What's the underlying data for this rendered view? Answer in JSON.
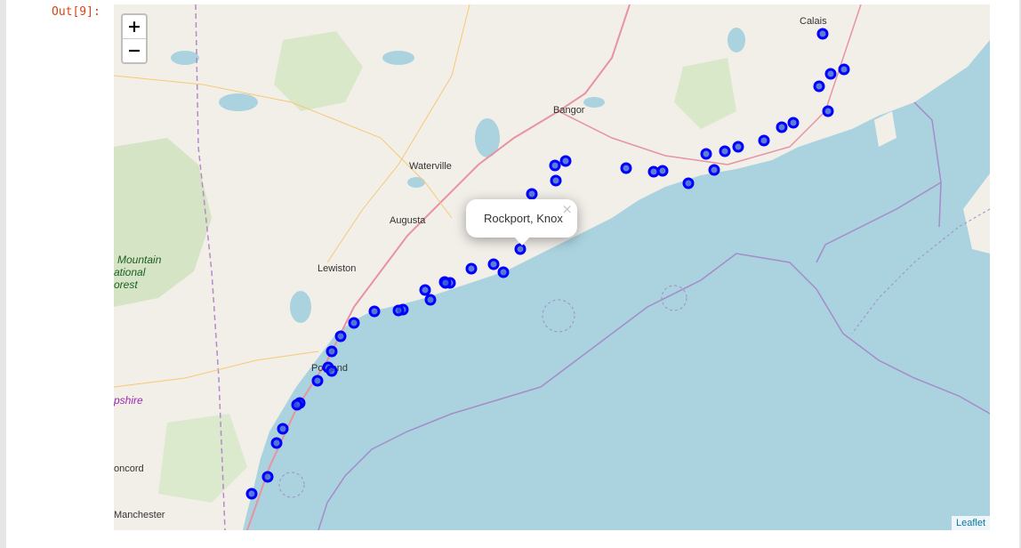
{
  "notebook": {
    "out_prompt": "Out[9]:"
  },
  "map": {
    "zoom_in_label": "+",
    "zoom_out_label": "−",
    "attribution": "Leaflet",
    "colors": {
      "water": "#aad3df",
      "land": "#f2efe9",
      "marker_stroke": "#0000ff",
      "marker_fill": "#3a60d0"
    },
    "popup": {
      "text": "Rockport, Knox",
      "close_label": "×"
    },
    "labels": [
      {
        "text": "Calais",
        "kind": "city"
      },
      {
        "text": "Bangor",
        "kind": "city"
      },
      {
        "text": "Waterville",
        "kind": "city"
      },
      {
        "text": "Augusta",
        "kind": "city"
      },
      {
        "text": "Lewiston",
        "kind": "city"
      },
      {
        "text": "Portland",
        "kind": "city"
      },
      {
        "text": "oncord",
        "kind": "city"
      },
      {
        "text": "Manchester",
        "kind": "city"
      },
      {
        "text": "Mountain",
        "kind": "area"
      },
      {
        "text": "ational",
        "kind": "area"
      },
      {
        "text": "orest",
        "kind": "area"
      },
      {
        "text": "pshire",
        "kind": "state"
      }
    ],
    "markers_count": 44
  }
}
